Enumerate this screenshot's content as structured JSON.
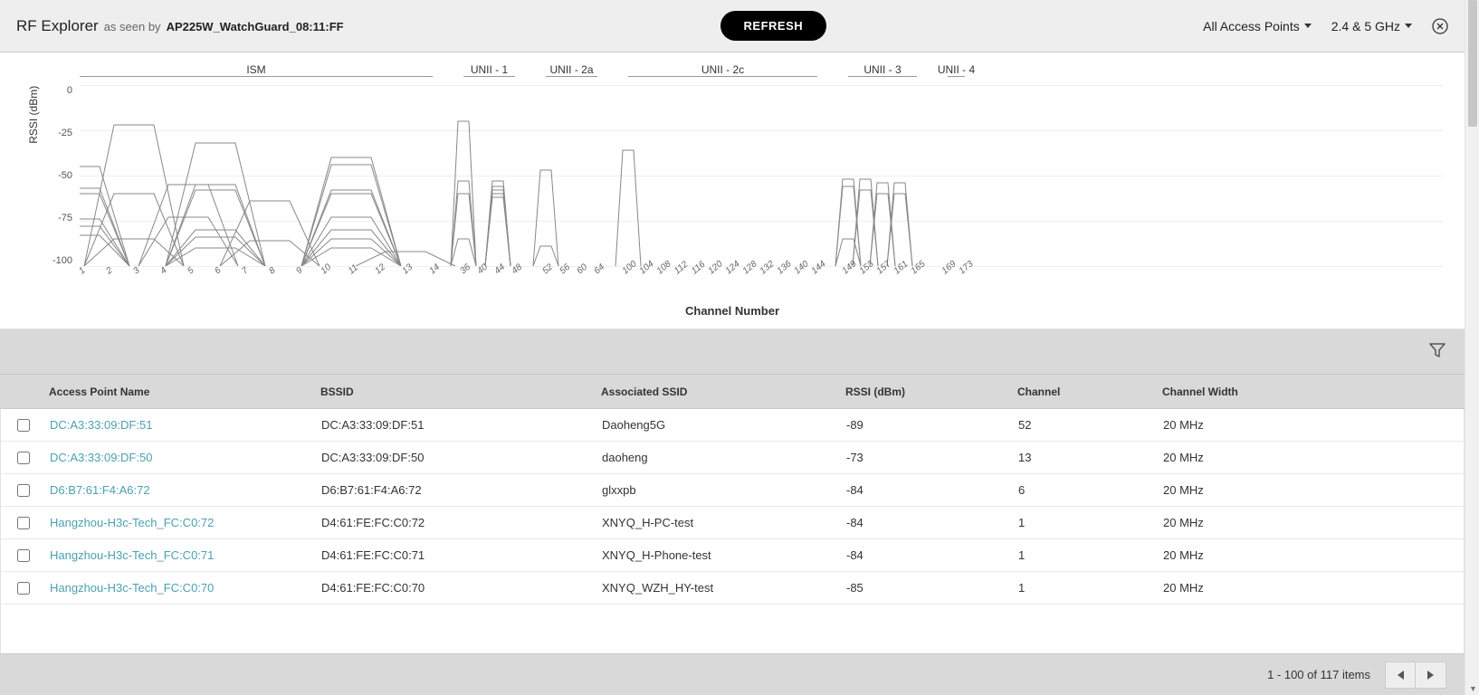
{
  "header": {
    "title": "RF Explorer",
    "as_seen_by": "as seen by",
    "ap_name": "AP225W_WatchGuard_08:11:FF",
    "refresh": "REFRESH",
    "filter_ap": "All Access Points",
    "filter_band": "2.4 & 5 GHz"
  },
  "chart_data": {
    "type": "line",
    "ylabel": "RSSI (dBm)",
    "xlabel": "Channel Number",
    "ylim": [
      -100,
      0
    ],
    "yticks": [
      0,
      -25,
      -50,
      -75,
      -100
    ],
    "bands": [
      {
        "name": "ISM",
        "channels": [
          1,
          2,
          3,
          4,
          5,
          6,
          7,
          8,
          9,
          10,
          11,
          12,
          13,
          14
        ],
        "highlight": [
          8,
          10
        ]
      },
      {
        "name": "UNII - 1",
        "channels": [
          36,
          40,
          44,
          48
        ]
      },
      {
        "name": "UNII - 2a",
        "channels": [
          52,
          56,
          60,
          64
        ]
      },
      {
        "name": "UNII - 2c",
        "channels": [
          100,
          104,
          108,
          112,
          116,
          120,
          124,
          128,
          132,
          136,
          140,
          144
        ]
      },
      {
        "name": "UNII - 3",
        "channels": [
          149,
          153,
          157,
          161,
          165
        ]
      },
      {
        "name": "UNII - 4",
        "channels": [
          169,
          173
        ]
      }
    ],
    "series_2g": [
      {
        "center": 1,
        "peak": -45
      },
      {
        "center": 1,
        "peak": -57
      },
      {
        "center": 1,
        "peak": -60
      },
      {
        "center": 1,
        "peak": -74
      },
      {
        "center": 1,
        "peak": -78
      },
      {
        "center": 1,
        "peak": -83
      },
      {
        "center": 3,
        "peak": -22
      },
      {
        "center": 3,
        "peak": -60
      },
      {
        "center": 3,
        "peak": -85
      },
      {
        "center": 5,
        "peak": -55
      },
      {
        "center": 5,
        "peak": -73
      },
      {
        "center": 6,
        "peak": -32
      },
      {
        "center": 6,
        "peak": -55
      },
      {
        "center": 6,
        "peak": -58
      },
      {
        "center": 6,
        "peak": -80
      },
      {
        "center": 6,
        "peak": -84
      },
      {
        "center": 6,
        "peak": -90
      },
      {
        "center": 8,
        "peak": -64
      },
      {
        "center": 8,
        "peak": -86
      },
      {
        "center": 11,
        "peak": -40
      },
      {
        "center": 11,
        "peak": -44
      },
      {
        "center": 11,
        "peak": -58
      },
      {
        "center": 11,
        "peak": -60
      },
      {
        "center": 11,
        "peak": -73
      },
      {
        "center": 11,
        "peak": -80
      },
      {
        "center": 11,
        "peak": -85
      },
      {
        "center": 11,
        "peak": -90
      },
      {
        "center": 13,
        "peak": -92
      }
    ],
    "series_5g": [
      {
        "center": 36,
        "peak": -20
      },
      {
        "center": 36,
        "peak": -53
      },
      {
        "center": 36,
        "peak": -60
      },
      {
        "center": 36,
        "peak": -85
      },
      {
        "center": 44,
        "peak": -53
      },
      {
        "center": 44,
        "peak": -56
      },
      {
        "center": 44,
        "peak": -58
      },
      {
        "center": 44,
        "peak": -60
      },
      {
        "center": 44,
        "peak": -62
      },
      {
        "center": 52,
        "peak": -47
      },
      {
        "center": 52,
        "peak": -89
      },
      {
        "center": 100,
        "peak": -36
      },
      {
        "center": 149,
        "peak": -52
      },
      {
        "center": 149,
        "peak": -56
      },
      {
        "center": 149,
        "peak": -85
      },
      {
        "center": 153,
        "peak": -52
      },
      {
        "center": 153,
        "peak": -58
      },
      {
        "center": 157,
        "peak": -54
      },
      {
        "center": 157,
        "peak": -60
      },
      {
        "center": 161,
        "peak": -54
      },
      {
        "center": 161,
        "peak": -60
      }
    ]
  },
  "table": {
    "columns": [
      "Access Point Name",
      "BSSID",
      "Associated SSID",
      "RSSI (dBm)",
      "Channel",
      "Channel Width"
    ],
    "rows": [
      {
        "ap": "DC:A3:33:09:DF:51",
        "bssid": "DC:A3:33:09:DF:51",
        "ssid": "Daoheng5G",
        "rssi": "-89",
        "ch": "52",
        "cw": "20 MHz"
      },
      {
        "ap": "DC:A3:33:09:DF:50",
        "bssid": "DC:A3:33:09:DF:50",
        "ssid": "daoheng",
        "rssi": "-73",
        "ch": "13",
        "cw": "20 MHz"
      },
      {
        "ap": "D6:B7:61:F4:A6:72",
        "bssid": "D6:B7:61:F4:A6:72",
        "ssid": "glxxpb",
        "rssi": "-84",
        "ch": "6",
        "cw": "20 MHz"
      },
      {
        "ap": "Hangzhou-H3c-Tech_FC:C0:72",
        "bssid": "D4:61:FE:FC:C0:72",
        "ssid": "XNYQ_H-PC-test",
        "rssi": "-84",
        "ch": "1",
        "cw": "20 MHz"
      },
      {
        "ap": "Hangzhou-H3c-Tech_FC:C0:71",
        "bssid": "D4:61:FE:FC:C0:71",
        "ssid": "XNYQ_H-Phone-test",
        "rssi": "-84",
        "ch": "1",
        "cw": "20 MHz"
      },
      {
        "ap": "Hangzhou-H3c-Tech_FC:C0:70",
        "bssid": "D4:61:FE:FC:C0:70",
        "ssid": "XNYQ_WZH_HY-test",
        "rssi": "-85",
        "ch": "1",
        "cw": "20 MHz"
      }
    ],
    "page_info": "1 - 100 of 117 items"
  }
}
